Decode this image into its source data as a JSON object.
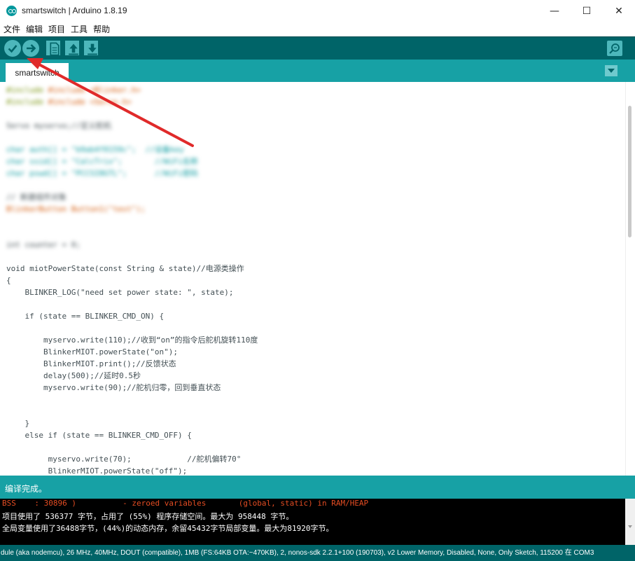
{
  "window": {
    "title": "smartswitch | Arduino 1.8.19",
    "minimize_glyph": "—",
    "maximize_glyph": "☐",
    "close_glyph": "✕"
  },
  "menu": [
    "文件",
    "编辑",
    "项目",
    "工具",
    "帮助"
  ],
  "toolbar": {
    "buttons": [
      "verify-icon",
      "upload-icon",
      "new-icon",
      "open-icon",
      "save-icon",
      "serial-monitor-icon"
    ]
  },
  "tabs": [
    {
      "label": "smartswitch"
    }
  ],
  "code": {
    "blurred": [
      "#include <Blinker.h>",
      "#include <Servo.h>",
      "Servo myservo;//定义舵机",
      "char auth[] = \"b9ab4f0159c\";  //设备key",
      "char ssid[] = \"CalcTrix\";       //WiFi名称",
      "char pswd[] = \"PCCSI8GTL\";      //WiFi密码",
      "// 新建组件对象",
      "BlinkerButton Button1(\"test\");",
      "int counter = 0;"
    ],
    "lines": [
      "void miotPowerState(const String & state)//电源类操作",
      "{",
      "    BLINKER_LOG(\"need set power state: \", state);",
      "",
      "    if (state == BLINKER_CMD_ON) {",
      "",
      "        myservo.write(110);//收到“on”的指令后舵机旋转110度",
      "        BlinkerMIOT.powerState(\"on\");",
      "        BlinkerMIOT.print();//反馈状态",
      "        delay(500);//延时0.5秒",
      "        myservo.write(90);//舵机归零，回到垂直状态",
      "",
      "",
      "    }",
      "    else if (state == BLINKER_CMD_OFF) {",
      "",
      "         myservo.write(70);            //舵机偏转70°",
      "         BlinkerMIOT.powerState(\"off\");"
    ]
  },
  "status": {
    "message": "编译完成。"
  },
  "console": {
    "lines": [
      "BSS    : 30896 )          - zeroed variables       (global, static) in RAM/HEAP",
      "项目使用了 536377 字节，占用了 (55%) 程序存储空间。最大为 958448 字节。",
      "全局变量使用了36488字节，(44%)的动态内存，余留45432字节局部变量。最大为81920字节。"
    ]
  },
  "board": {
    "text": "dule (aka nodemcu), 26 MHz, 40MHz, DOUT (compatible), 1MB (FS:64KB OTA:~470KB), 2, nonos-sdk 2.2.1+100 (190703), v2 Lower Memory, Disabled, None, Only Sketch, 115200 在 COM3"
  },
  "colors": {
    "toolbar": "#006468",
    "tabbar": "#17a1a5",
    "button": "#4db7bb",
    "annotation_arrow": "#e02a2a"
  }
}
